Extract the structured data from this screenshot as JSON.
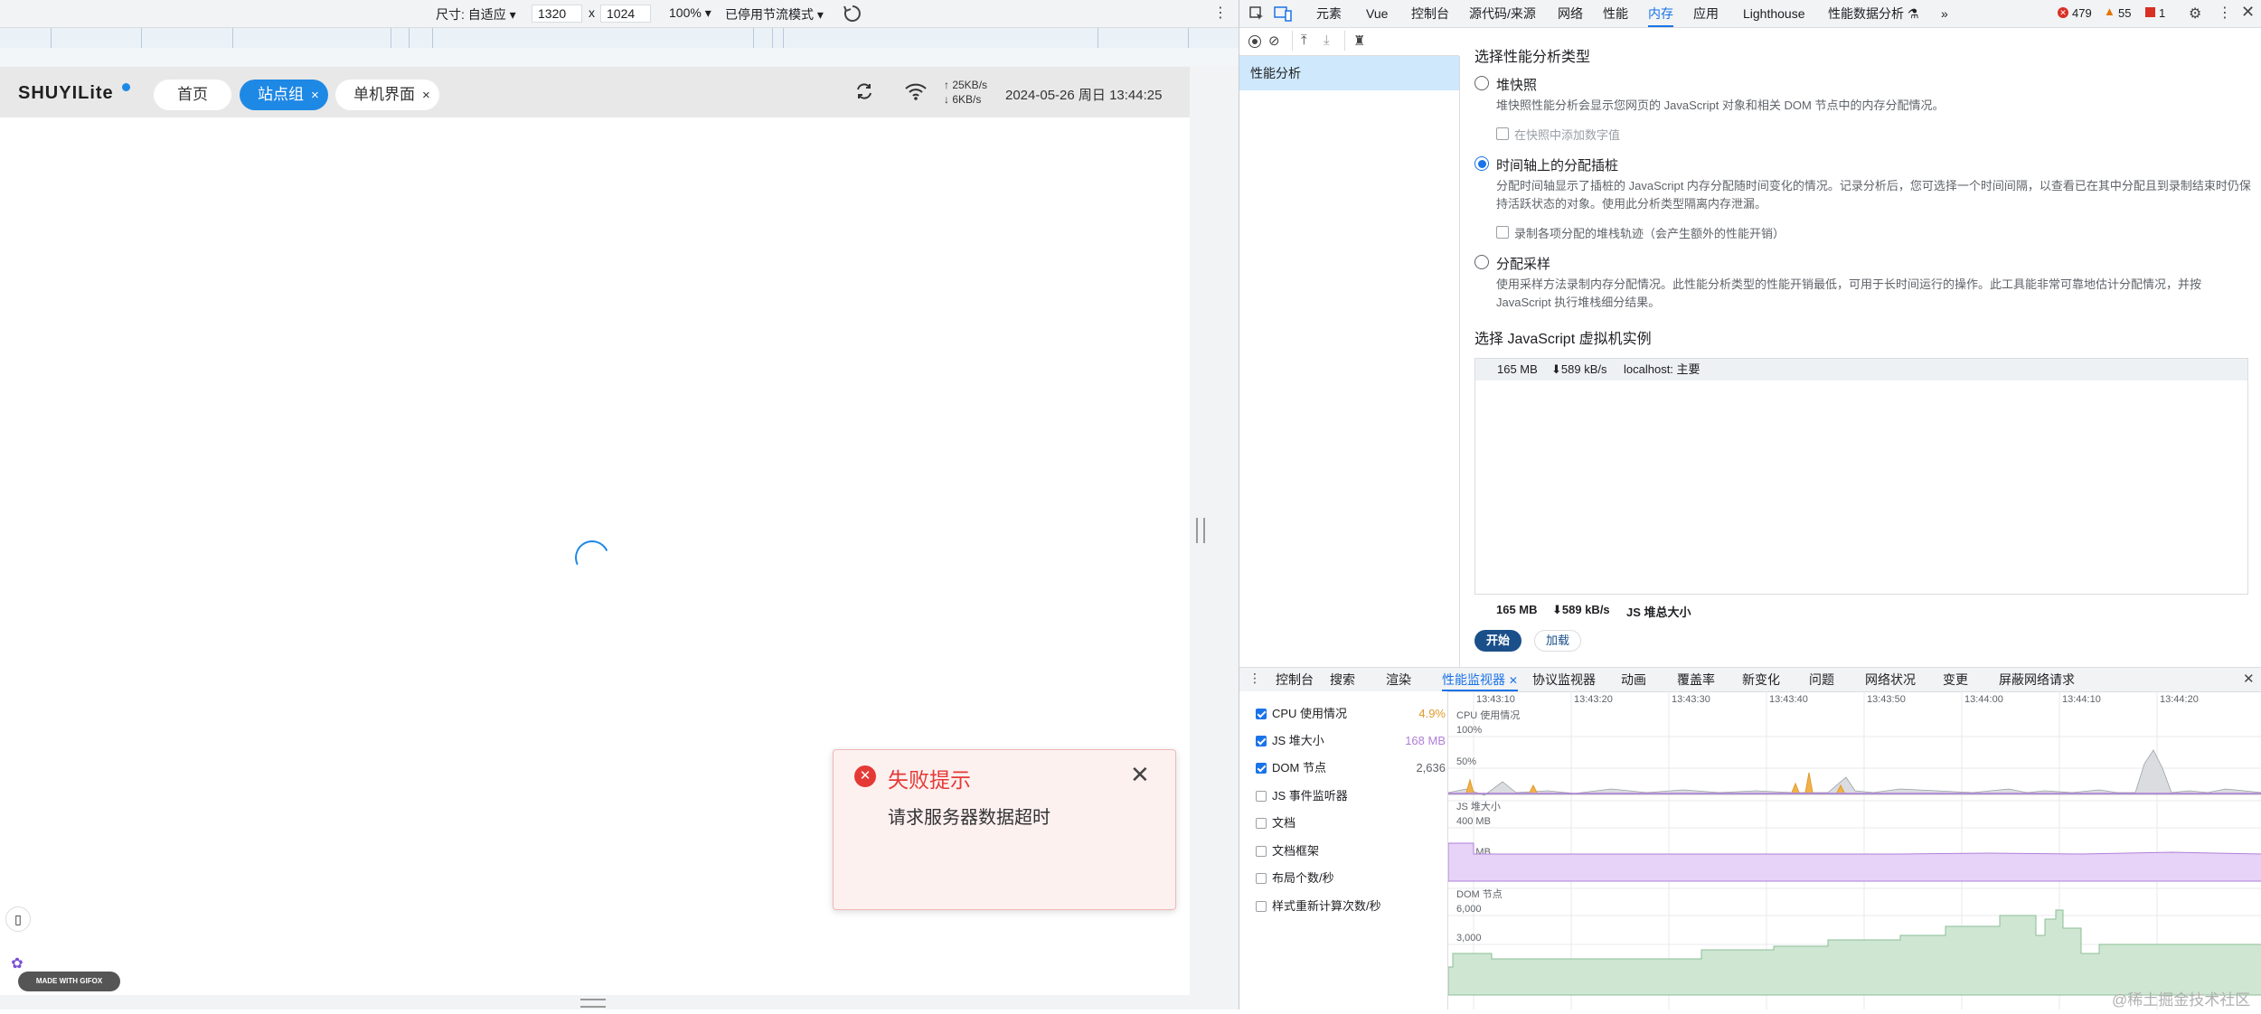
{
  "device_toolbar": {
    "size_label": "尺寸: 自适应 ▾",
    "width": "1320",
    "times": "x",
    "height": "1024",
    "zoom": "100% ▾",
    "throttle": "已停用节流模式 ▾"
  },
  "app": {
    "logo": "SHUYILite",
    "tabs": [
      {
        "label": "首页",
        "closable": false
      },
      {
        "label": "站点组",
        "closable": true
      },
      {
        "label": "单机界面",
        "closable": true
      }
    ],
    "close_glyph": "×",
    "upload_speed": "↑ 25KB/s",
    "download_speed": "↓ 6KB/s",
    "datetime": "2024-05-26 周日 13:44:25"
  },
  "toast": {
    "title": "失败提示",
    "message": "请求服务器数据超时"
  },
  "gifox_label": "MADE WITH GIFOX",
  "devtools": {
    "tabs": [
      "元素",
      "Vue",
      "控制台",
      "源代码/来源",
      "网络",
      "性能",
      "内存",
      "应用",
      "Lighthouse",
      "性能数据分析 ⚗",
      "»"
    ],
    "active_tab": "内存",
    "errors": "479",
    "warnings": "55",
    "issues": "1",
    "sidebar_item": "性能分析",
    "memory": {
      "select_type_title": "选择性能分析类型",
      "options": [
        {
          "label": "堆快照",
          "desc": "堆快照性能分析会显示您网页的 JavaScript 对象和相关 DOM 节点中的内存分配情况。",
          "checkbox": "在快照中添加数字值",
          "selected": false
        },
        {
          "label": "时间轴上的分配插桩",
          "desc": "分配时间轴显示了插桩的 JavaScript 内存分配随时间变化的情况。记录分析后，您可选择一个时间间隔，以查看已在其中分配且到录制结束时仍保持活跃状态的对象。使用此分析类型隔离内存泄漏。",
          "checkbox": "录制各项分配的堆栈轨迹（会产生额外的性能开销）",
          "selected": true
        },
        {
          "label": "分配采样",
          "desc": "使用采样方法录制内存分配情况。此性能分析类型的性能开销最低，可用于长时间运行的操作。此工具能非常可靠地估计分配情况，并按 JavaScript 执行堆栈细分结果。",
          "selected": false
        }
      ],
      "vm_title": "选择 JavaScript 虚拟机实例",
      "vm_row": {
        "size": "165 MB",
        "rate": "⬇589 kB/s",
        "name": "localhost: 主要"
      },
      "summary": {
        "size": "165 MB",
        "rate": "⬇589 kB/s",
        "label": "JS 堆总大小"
      },
      "start_button": "开始",
      "load_button": "加载"
    },
    "drawer": {
      "tabs": [
        "控制台",
        "搜索",
        "渲染",
        "性能监视器",
        "协议监视器",
        "动画",
        "覆盖率",
        "新变化",
        "问题",
        "网络状况",
        "变更",
        "屏蔽网络请求"
      ],
      "active_tab": "性能监视器"
    },
    "perf_monitor": {
      "metrics": [
        {
          "label": "CPU 使用情况",
          "value": "4.9%",
          "checked": true,
          "color": "#e09a2b"
        },
        {
          "label": "JS 堆大小",
          "value": "168 MB",
          "checked": true,
          "color": "#b07fd8"
        },
        {
          "label": "DOM 节点",
          "value": "2,636",
          "checked": true,
          "color": "#5f6368"
        },
        {
          "label": "JS 事件监听器",
          "value": "",
          "checked": false
        },
        {
          "label": "文档",
          "value": "",
          "checked": false
        },
        {
          "label": "文档框架",
          "value": "",
          "checked": false
        },
        {
          "label": "布局个数/秒",
          "value": "",
          "checked": false
        },
        {
          "label": "样式重新计算次数/秒",
          "value": "",
          "checked": false
        }
      ],
      "time_ticks": [
        "13:43:10",
        "13:43:20",
        "13:43:30",
        "13:43:40",
        "13:43:50",
        "13:44:00",
        "13:44:10",
        "13:44:20"
      ],
      "cpu_title": "CPU 使用情况",
      "cpu_ticks": [
        "100%",
        "50%"
      ],
      "heap_title": "JS 堆大小",
      "heap_ticks": [
        "400 MB",
        "200 MB"
      ],
      "dom_title": "DOM 节点",
      "dom_ticks": [
        "6,000",
        "3,000"
      ]
    }
  },
  "watermark": "@稀土掘金技术社区"
}
